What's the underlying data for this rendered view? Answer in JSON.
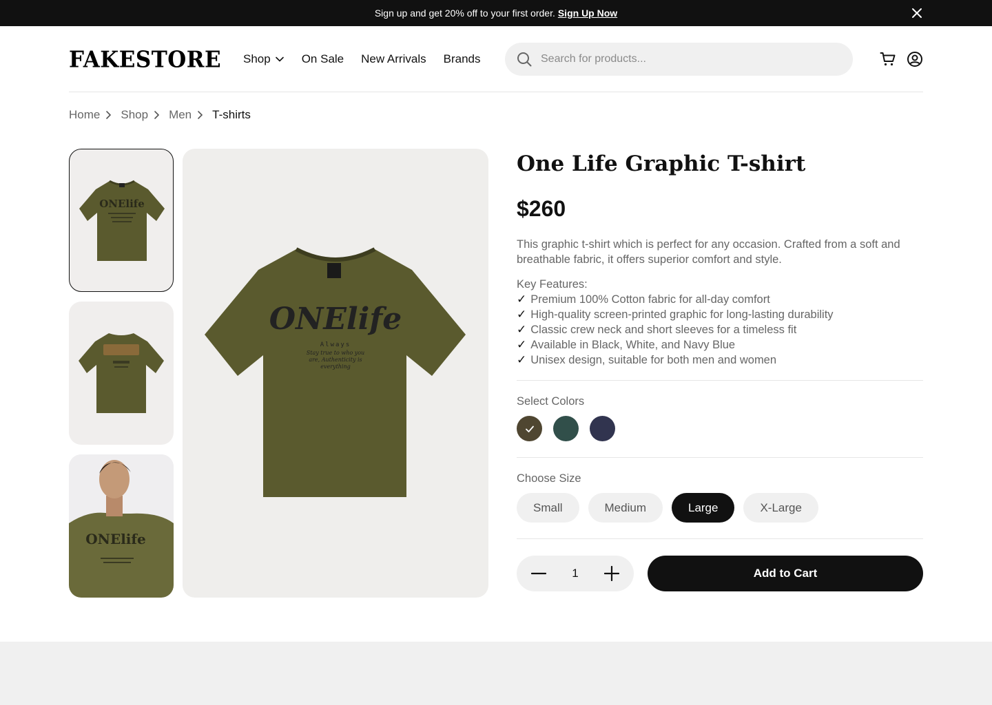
{
  "banner": {
    "text": "Sign up and get 20% off to your first order.",
    "link": "Sign Up Now"
  },
  "header": {
    "logo": "FAKESTORE",
    "nav": [
      "Shop",
      "On Sale",
      "New Arrivals",
      "Brands"
    ],
    "search_placeholder": "Search for products..."
  },
  "breadcrumb": [
    "Home",
    "Shop",
    "Men",
    "T-shirts"
  ],
  "product": {
    "title": "One Life Graphic T-shirt",
    "price": "$260",
    "description": "This graphic t-shirt which is perfect for any occasion. Crafted from a soft and breathable fabric, it offers superior comfort and style.",
    "features_label": "Key Features:",
    "features": [
      "Premium 100% Cotton fabric for all-day comfort",
      "High-quality screen-printed graphic for long-lasting durability",
      "Classic crew neck and short sleeves for a timeless fit",
      "Available in Black, White, and Navy Blue",
      "Unisex design, suitable for both men and women"
    ],
    "graphic_text": "ONElife",
    "graphic_sub": "Always",
    "graphic_script": "Stay true to who you are, Authenticity is everything",
    "colors_label": "Select Colors",
    "colors": [
      "#4f4631",
      "#314f4a",
      "#31344f"
    ],
    "selected_color": 0,
    "size_label": "Choose Size",
    "sizes": [
      "Small",
      "Medium",
      "Large",
      "X-Large"
    ],
    "selected_size": "Large",
    "quantity": "1",
    "add_to_cart": "Add to Cart"
  }
}
